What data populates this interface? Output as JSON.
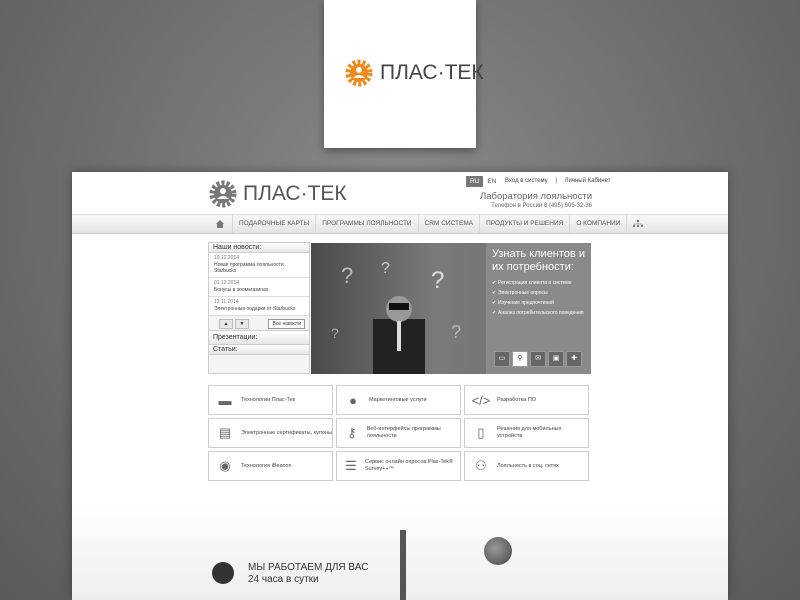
{
  "card": {
    "logo_text": "ПЛАС·ТЕК",
    "accent": "#f08a1c"
  },
  "header": {
    "logo_text": "ПЛАС·ТЕК",
    "lang_ru": "RU",
    "lang_en": "EN",
    "login": "Вход в систему",
    "sep": "|",
    "cabinet": "Личный Кабинет",
    "slogan": "Лаборатория лояльности",
    "phone": "Телефон в России 8 (495) 605-32-36"
  },
  "nav": {
    "items": [
      "ПОДАРОЧНЫЕ КАРТЫ",
      "ПРОГРАММЫ ЛОЯЛЬНОСТИ",
      "CRM СИСТЕМА",
      "ПРОДУКТЫ И РЕШЕНИЯ",
      "О КОМПАНИИ"
    ]
  },
  "news": {
    "title": "Наши новости:",
    "items": [
      {
        "date": "10.12.2014",
        "text": "Новая программа лояльности Starbucks"
      },
      {
        "date": "01.12.2014",
        "text": "Бонусы в зоомагазинах"
      },
      {
        "date": "12.11.2014",
        "text": "Электронные подарки от Starbucks"
      }
    ],
    "all": "Все новости",
    "presentations": "Презентации:",
    "articles": "Статьи:"
  },
  "banner": {
    "title": "Узнать клиентов и их потребности:",
    "bullets": [
      "Регистрация клиента в системе",
      "Электронные опросы",
      "Изучение предпочтений",
      "Анализ потребительского поведения"
    ]
  },
  "tiles": [
    "Технологии Плас-Тек",
    "Маркетинговые услуги",
    "Разработка ПО",
    "Электронные сертификаты, купоны",
    "Веб-интерфейсы программы лояльности",
    "Решения для мобильных устройств",
    "Технология iBeacon",
    "Сервис онлайн опросов Plas-Tek® Survey++™",
    "Лояльность в соц. сетях"
  ],
  "bottom": {
    "line1": "МЫ РАБОТАЕМ ДЛЯ ВАС",
    "line2": "24 часа в сутки"
  }
}
